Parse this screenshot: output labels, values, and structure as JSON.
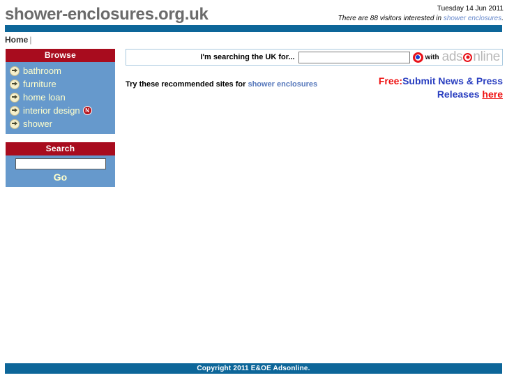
{
  "header": {
    "site_title": "shower-enclosures.org.uk",
    "date": "Tuesday 14 Jun 2011",
    "visitors_prefix": "There are 88 visitors interested in ",
    "visitors_keyword": "shower enclosures",
    "visitors_suffix": "."
  },
  "nav": {
    "home_label": "Home",
    "separator": "|"
  },
  "sidebar": {
    "browse": {
      "title": "Browse",
      "items": [
        {
          "label": "bathroom",
          "badge": ""
        },
        {
          "label": "furniture",
          "badge": ""
        },
        {
          "label": "home loan",
          "badge": ""
        },
        {
          "label": "interior design",
          "badge": "N"
        },
        {
          "label": "shower",
          "badge": ""
        }
      ]
    },
    "search": {
      "title": "Search",
      "input_value": "",
      "input_placeholder": "",
      "go_label": "Go"
    }
  },
  "main": {
    "searchbar": {
      "label": "I'm searching the UK for...",
      "input_value": "",
      "input_placeholder": "",
      "with_label": "with",
      "logo_part1": "ads",
      "logo_part2": "nline"
    },
    "recommend": {
      "prefix": "Try these recommended sites for ",
      "keyword": "shower enclosures"
    },
    "promo": {
      "free_label": "Free:",
      "line1": "Submit News & Press",
      "line2": "Releases ",
      "here_label": "here"
    }
  },
  "footer": {
    "copyright": "Copyright 2011 E&OE Adsonline."
  },
  "colors": {
    "bar_blue": "#0d6699",
    "panel_red": "#a80c1e",
    "panel_blue": "#6699cc",
    "link_blue": "#5577bb",
    "promo_red": "#ee1111",
    "promo_blue": "#2a3fc0",
    "title_gray": "#6b6b6b"
  }
}
